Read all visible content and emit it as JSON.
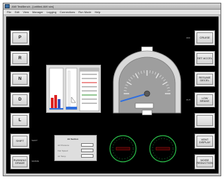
{
  "window": {
    "title": "AMI TestBench - [untitled.AMI sim]"
  },
  "menu": [
    "File",
    "Edit",
    "View",
    "Manager",
    "Logging",
    "Connections",
    "Run Mode",
    "Help"
  ],
  "left_buttons": [
    {
      "label": "P"
    },
    {
      "label": "R"
    },
    {
      "label": "N"
    },
    {
      "label": "D"
    },
    {
      "label": "L"
    },
    {
      "label": "SHIFT"
    },
    {
      "label": "RUNNING GRADE"
    }
  ],
  "right_buttons": [
    {
      "label": "CRUISE"
    },
    {
      "label": "SET ACCEL"
    },
    {
      "label": "RESUME DECEL"
    },
    {
      "label": "LOW BRAKE"
    },
    {
      "label": ""
    },
    {
      "label": "VENT DISPLAY"
    },
    {
      "label": "NOISE REDUCTION"
    }
  ],
  "side_labels": {
    "shift_side": "SHIFT",
    "grade_side": "GRADE",
    "cruise_side": "OFF",
    "brake_side": "OUT"
  },
  "temp_panel": {
    "list_rows": 8,
    "accent_colors": [
      "#d22",
      "#2a8f2a"
    ]
  },
  "air_section": {
    "title": "Air Section",
    "rows": [
      "Air Pressure",
      "Fan Speed",
      "Air Temp"
    ]
  },
  "speedometer": {
    "needle_level": 0.12,
    "top_label": "",
    "odometer": "",
    "trip": ""
  },
  "gauges": [
    {
      "name": "left-round-gauge",
      "color": "#2bbf4a",
      "readout": ""
    },
    {
      "name": "right-round-gauge",
      "color": "#2bbf4a",
      "readout": ""
    }
  ],
  "colors": {
    "accent": "#2f6fe0",
    "gauge_green": "#2bbf4a",
    "readout_red": "#e02020"
  }
}
